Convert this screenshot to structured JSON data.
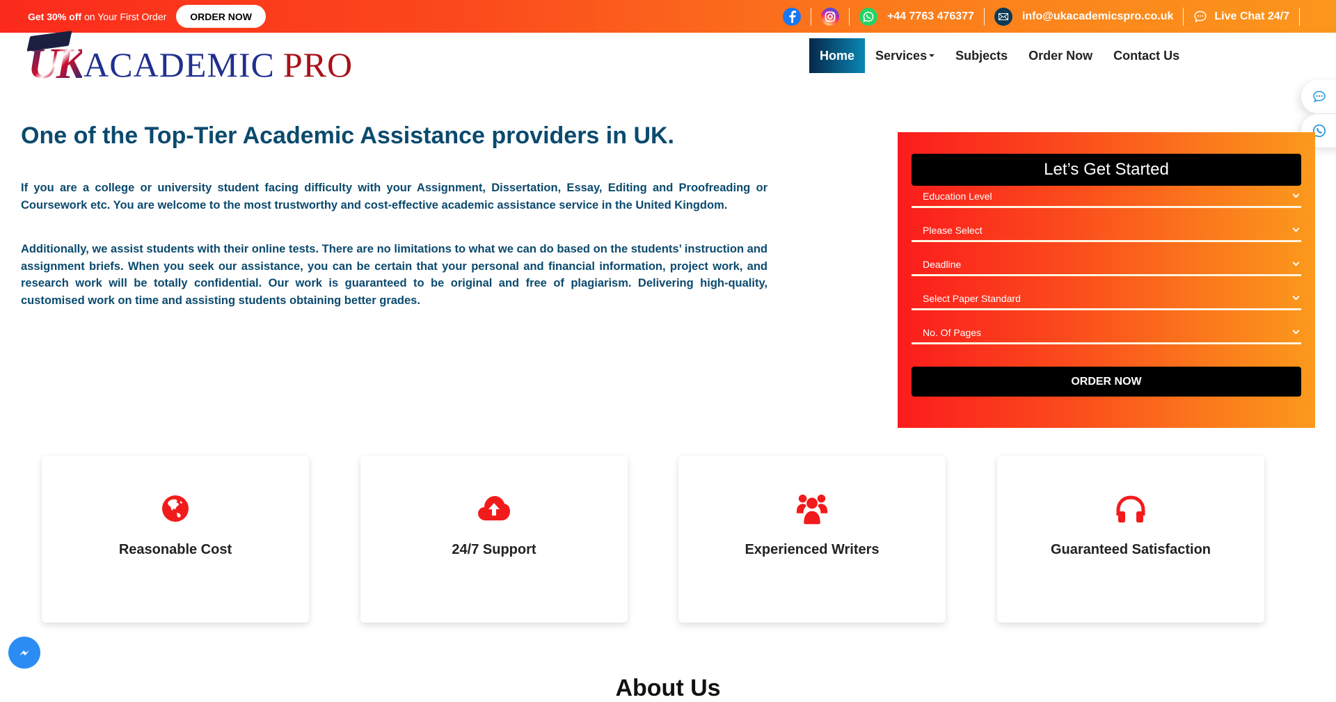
{
  "topbar": {
    "promo_bold": "Get 30% off",
    "promo_text": "on Your First Order",
    "promo_button": "ORDER NOW",
    "phone": "+44 7763 476377",
    "email": "info@ukacademicspro.co.uk",
    "live_chat": "Live Chat 24/7",
    "gradient_start": "#fb2a1c",
    "gradient_end": "#fb961c"
  },
  "logo": {
    "part1": "UK",
    "part2": "ACADEMIC",
    "part3": "PRO"
  },
  "nav": {
    "items": [
      {
        "label": "Home",
        "active": true
      },
      {
        "label": "Services",
        "dropdown": true
      },
      {
        "label": "Subjects"
      },
      {
        "label": "Order Now"
      },
      {
        "label": "Contact Us"
      }
    ]
  },
  "hero": {
    "title": "One of the Top-Tier Academic Assistance providers in UK.",
    "paragraph1": "If you are a college or university student facing difficulty with your Assignment, Dissertation, Essay, Editing and Proofreading or Coursework etc. You are welcome to the most trustworthy and cost-effective academic assistance service in the United Kingdom.",
    "paragraph2": "Additionally, we assist students with their online tests. There are no limitations to what we can do based on the students’ instruction and assignment briefs. When you seek our assistance, you can be certain that your personal and financial information, project work, and research work will be totally confidential. Our work is guaranteed to be original and free of plagiarism. Delivering high-quality, customised work on time and assisting students obtaining better grades."
  },
  "order_form": {
    "heading": "Let’s Get Started",
    "selects": [
      {
        "name": "education-level",
        "value": "Education Level"
      },
      {
        "name": "paper-type",
        "value": "Please Select"
      },
      {
        "name": "deadline",
        "value": "Deadline"
      },
      {
        "name": "paper-standard",
        "value": "Select Paper Standard"
      },
      {
        "name": "pages",
        "value": "No. Of Pages"
      }
    ],
    "submit_label": "ORDER NOW"
  },
  "features": [
    {
      "icon": "globe-icon",
      "label": "Reasonable Cost"
    },
    {
      "icon": "cloud-upload-icon",
      "label": "24/7 Support"
    },
    {
      "icon": "users-icon",
      "label": "Experienced Writers"
    },
    {
      "icon": "headphones-icon",
      "label": "Guaranteed Satisfaction"
    }
  ],
  "accent_color": "#f21b1b",
  "next_section_title": "About Us"
}
